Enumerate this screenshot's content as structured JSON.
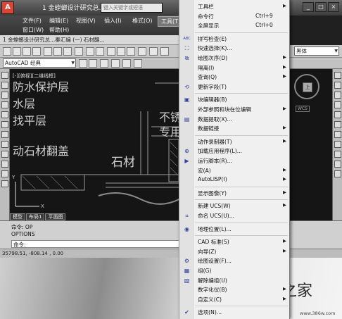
{
  "window": {
    "title": "1 金螳螂设计研究总...",
    "search_placeholder": "键入关键字或短语",
    "logo": "A",
    "controls": [
      "_",
      "□",
      "×"
    ]
  },
  "menubar": {
    "file": "文件(F)",
    "edit": "编辑(E)",
    "view": "视图(V)",
    "insert": "插入(I)",
    "format": "格式(O)",
    "tools": "工具(T)",
    "window": "窗口(W)",
    "help": "帮助(H)"
  },
  "doc_tab": "1 金螳螂设计研究总...秦汇编 (一) 石材翻...",
  "toolbar": {
    "workspace": "AutoCAD 经典",
    "font_combo": "黑体"
  },
  "canvas": {
    "view_label": "[-][俯视][二维线框]",
    "texts": [
      "防水保护层",
      "水层",
      "找平层",
      "动石材翻盖",
      "石材",
      "不锈",
      "专用"
    ],
    "axis_y": "Y",
    "axis_x": "X",
    "compass_face": "上",
    "wcs": "WCS"
  },
  "layout_tabs": [
    "模型",
    "布局1",
    "平面图"
  ],
  "command": {
    "line1": "命令: OP",
    "line2": "OPTIONS",
    "prompt": "命令:"
  },
  "status": {
    "coords": "35798.51, -808.14 , 0.00"
  },
  "watermark": {
    "text": "系统之家",
    "url": "www.386w.com"
  },
  "tools_menu": {
    "items": [
      {
        "label": "工具栏",
        "shortcut": "",
        "submenu": true,
        "icon": ""
      },
      {
        "label": "命令行",
        "shortcut": "Ctrl+9",
        "submenu": false,
        "icon": ""
      },
      {
        "label": "全屏显示",
        "shortcut": "Ctrl+0",
        "submenu": false,
        "icon": ""
      },
      {
        "label": "拼写检查(E)",
        "shortcut": "",
        "submenu": false,
        "icon": "ABC"
      },
      {
        "label": "快速选择(K)...",
        "shortcut": "",
        "submenu": false,
        "icon": "⛶"
      },
      {
        "label": "绘图次序(D)",
        "shortcut": "",
        "submenu": true,
        "icon": "⧉"
      },
      {
        "label": "隔离(I)",
        "shortcut": "",
        "submenu": true,
        "icon": ""
      },
      {
        "label": "查询(Q)",
        "shortcut": "",
        "submenu": true,
        "icon": ""
      },
      {
        "label": "更新字段(T)",
        "shortcut": "",
        "submenu": false,
        "icon": "⟲"
      },
      {
        "label": "块编辑器(B)",
        "shortcut": "",
        "submenu": false,
        "icon": "▣"
      },
      {
        "label": "外部参照和块在位编辑",
        "shortcut": "",
        "submenu": true,
        "icon": ""
      },
      {
        "label": "数据提取(X)...",
        "shortcut": "",
        "submenu": false,
        "icon": "▤"
      },
      {
        "label": "数据链接",
        "shortcut": "",
        "submenu": true,
        "icon": ""
      },
      {
        "label": "动作录制器(T)",
        "shortcut": "",
        "submenu": true,
        "icon": ""
      },
      {
        "label": "加载应用程序(L)...",
        "shortcut": "",
        "submenu": false,
        "icon": "⊕"
      },
      {
        "label": "运行脚本(R)...",
        "shortcut": "",
        "submenu": false,
        "icon": "▶"
      },
      {
        "label": "宏(A)",
        "shortcut": "",
        "submenu": true,
        "icon": ""
      },
      {
        "label": "AutoLISP(I)",
        "shortcut": "",
        "submenu": true,
        "icon": ""
      },
      {
        "label": "显示图像(Y)",
        "shortcut": "",
        "submenu": true,
        "icon": ""
      },
      {
        "label": "新建 UCS(W)",
        "shortcut": "",
        "submenu": true,
        "icon": ""
      },
      {
        "label": "命名 UCS(U)...",
        "shortcut": "",
        "submenu": false,
        "icon": "⌗"
      },
      {
        "label": "地理位置(L)...",
        "shortcut": "",
        "submenu": false,
        "icon": "◉"
      },
      {
        "label": "CAD 标准(S)",
        "shortcut": "",
        "submenu": true,
        "icon": ""
      },
      {
        "label": "向导(Z)",
        "shortcut": "",
        "submenu": true,
        "icon": ""
      },
      {
        "label": "绘图设置(F)...",
        "shortcut": "",
        "submenu": false,
        "icon": "⚙"
      },
      {
        "label": "组(G)",
        "shortcut": "",
        "submenu": false,
        "icon": "▦"
      },
      {
        "label": "解除编组(U)",
        "shortcut": "",
        "submenu": false,
        "icon": "▧"
      },
      {
        "label": "数字化仪(B)",
        "shortcut": "",
        "submenu": true,
        "icon": ""
      },
      {
        "label": "自定义(C)",
        "shortcut": "",
        "submenu": true,
        "icon": ""
      },
      {
        "label": "选项(N)...",
        "shortcut": "",
        "submenu": false,
        "icon": "✔"
      }
    ]
  }
}
